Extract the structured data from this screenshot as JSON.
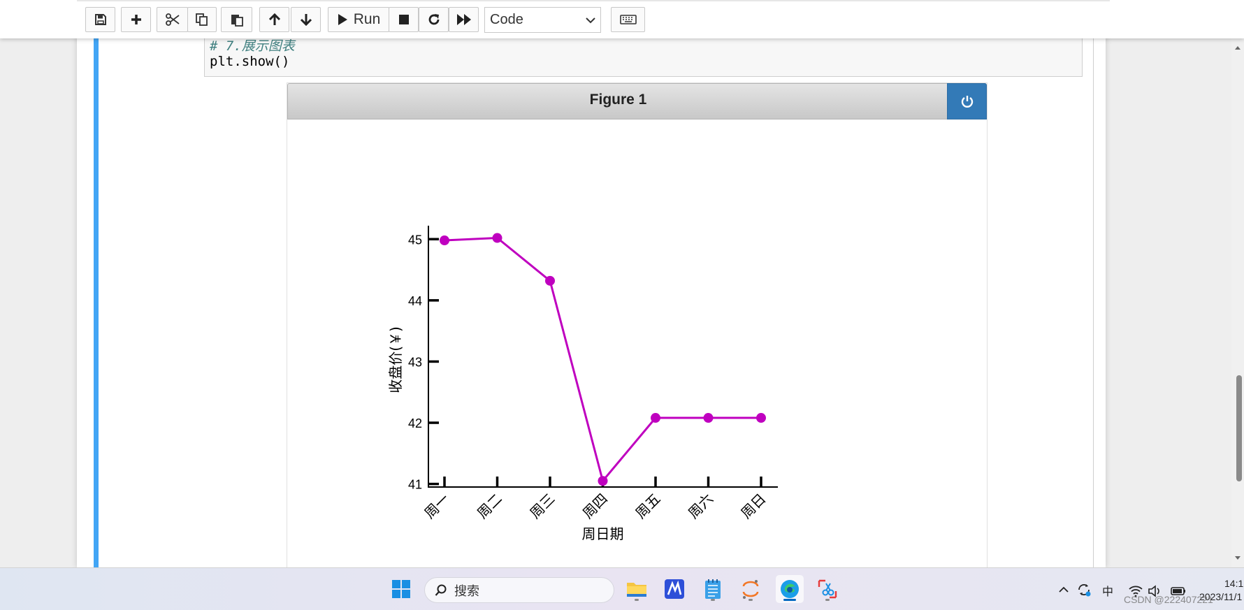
{
  "toolbar": {
    "run_label": "Run",
    "cell_type": "Code",
    "icons": [
      "save-icon",
      "plus-icon",
      "scissors-icon",
      "copy-icon",
      "paste-icon",
      "arrow-up-icon",
      "arrow-down-icon",
      "play-icon",
      "stop-icon",
      "restart-icon",
      "fast-forward-icon",
      "keyboard-icon"
    ]
  },
  "code": {
    "comment_line": "# 7.展示图表",
    "code_line": "plt.show()"
  },
  "figure": {
    "title": "Figure 1"
  },
  "chart_data": {
    "type": "line",
    "categories": [
      "周一",
      "周二",
      "周三",
      "周四",
      "周五",
      "周六",
      "周日"
    ],
    "values": [
      44.98,
      45.02,
      44.32,
      41.05,
      42.08,
      42.08,
      42.08
    ],
    "xlabel": "周日期",
    "ylabel": "收盘价(￥)",
    "ylim": [
      40.95,
      45.22
    ],
    "yticks": [
      41,
      42,
      43,
      44,
      45
    ],
    "line_color": "#bf00bf",
    "grid": false
  },
  "taskbar": {
    "search_placeholder": "搜索",
    "ime_label": "中",
    "time": "14:1",
    "date": "2023/11/1",
    "watermark": "CSDN @222407221",
    "colors": {
      "accent": "#0067c0"
    }
  }
}
